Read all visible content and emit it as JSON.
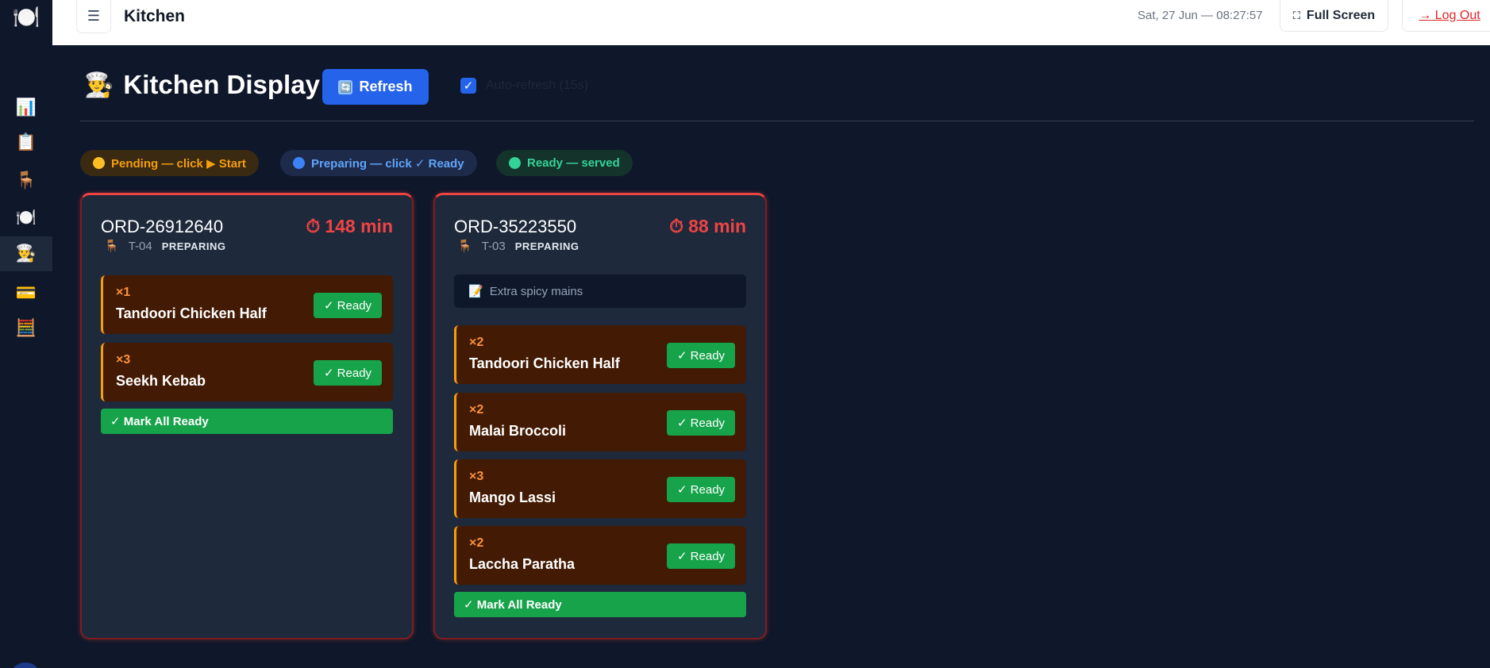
{
  "sidebar": {
    "logo_icon": "🍽️",
    "items": [
      {
        "name": "dashboard",
        "icon": "📊",
        "active": false
      },
      {
        "name": "orders",
        "icon": "📋",
        "active": false
      },
      {
        "name": "tables",
        "icon": "🪑",
        "active": false
      },
      {
        "name": "menu",
        "icon": "🍽️",
        "active": false
      },
      {
        "name": "kitchen",
        "icon": "👨‍🍳",
        "active": true
      },
      {
        "name": "payments",
        "icon": "💳",
        "active": false
      },
      {
        "name": "calculator",
        "icon": "🧮",
        "active": false
      }
    ]
  },
  "topbar": {
    "menu_icon": "☰",
    "page_name": "Kitchen",
    "clock": "Sat, 27 Jun — 08:27:57",
    "fullscreen_icon": "⛶",
    "fullscreen_label": "Full Screen",
    "logout_label": "→ Log Out"
  },
  "header": {
    "title_icon": "👨‍🍳",
    "title": "Kitchen Display",
    "refresh_icon": "🔄",
    "refresh_label": "Refresh",
    "auto_refresh_checked": true,
    "auto_refresh_label": "Auto-refresh (15s)"
  },
  "legend": [
    {
      "label": "Pending — click ▶ Start",
      "color": "#fbbf24"
    },
    {
      "label": "Preparing — click ✓ Ready",
      "color": "#3b82f6"
    },
    {
      "label": "Ready — served",
      "color": "#34d399"
    }
  ],
  "orders": [
    {
      "id": "ORD-26912640",
      "timer_icon": "⏱",
      "elapsed": "148 min",
      "table_icon": "🪑",
      "table": "T-04",
      "status": "PREPARING",
      "note": null,
      "items": [
        {
          "qty": "×1",
          "name": "Tandoori Chicken Half",
          "action": "✓ Ready"
        },
        {
          "qty": "×3",
          "name": "Seekh Kebab",
          "action": "✓ Ready"
        }
      ],
      "mark_all_label": "✓ Mark All Ready"
    },
    {
      "id": "ORD-35223550",
      "timer_icon": "⏱",
      "elapsed": "88 min",
      "table_icon": "🪑",
      "table": "T-03",
      "status": "PREPARING",
      "note_icon": "📝",
      "note": "Extra spicy mains",
      "items": [
        {
          "qty": "×2",
          "name": "Tandoori Chicken Half",
          "action": "✓ Ready"
        },
        {
          "qty": "×2",
          "name": "Malai Broccoli",
          "action": "✓ Ready"
        },
        {
          "qty": "×3",
          "name": "Mango Lassi",
          "action": "✓ Ready"
        },
        {
          "qty": "×2",
          "name": "Laccha Paratha",
          "action": "✓ Ready"
        }
      ],
      "mark_all_label": "✓ Mark All Ready"
    }
  ]
}
